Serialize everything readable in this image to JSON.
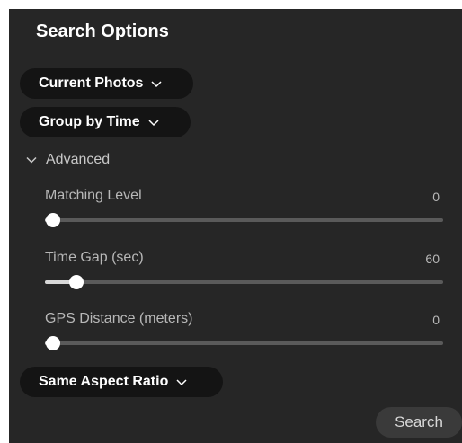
{
  "panel": {
    "title": "Search Options"
  },
  "scope_dropdown": {
    "label": "Current Photos",
    "icon": "chevron-down-icon"
  },
  "group_dropdown": {
    "label": "Group by Time",
    "icon": "chevron-down-icon"
  },
  "advanced": {
    "label": "Advanced",
    "expanded": true,
    "icon": "chevron-down-icon",
    "sliders": [
      {
        "label": "Matching Level",
        "value": "0",
        "fraction": 0.0
      },
      {
        "label": "Time Gap (sec)",
        "value": "60",
        "fraction": 0.06
      },
      {
        "label": "GPS Distance (meters)",
        "value": "0",
        "fraction": 0.0
      }
    ]
  },
  "aspect_dropdown": {
    "label": "Same Aspect Ratio",
    "icon": "chevron-down-icon"
  },
  "search_button": {
    "label": "Search"
  },
  "colors": {
    "panel_background": "#262626",
    "pill_background": "#141414",
    "track": "#5a5a5a",
    "thumb": "#ffffff"
  }
}
